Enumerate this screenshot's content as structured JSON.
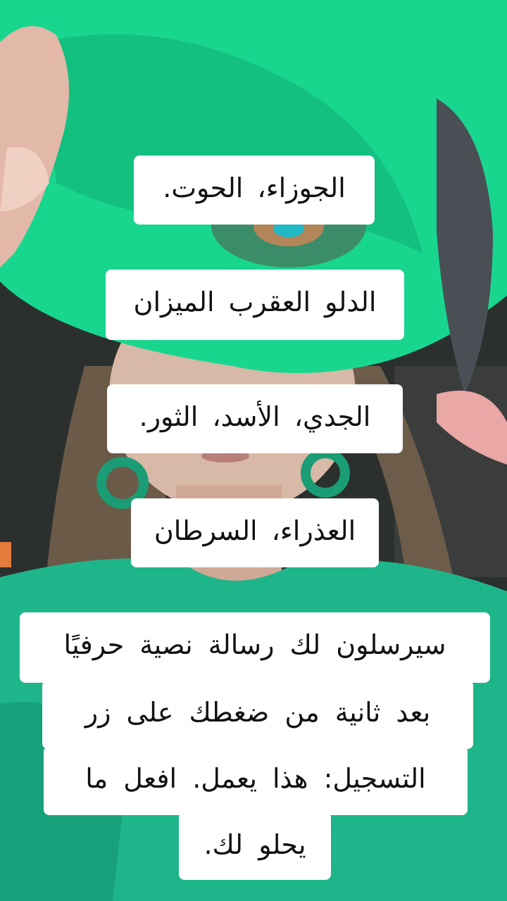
{
  "captions": [
    "الجوزاء، الحوت.",
    "الدلو العقرب الميزان",
    "الجدي، الأسد، الثور.",
    "العذراء، السرطان"
  ],
  "paragraph": {
    "lines": [
      "سيرسلون لك رسالة نصية حرفيًا",
      "بعد ثانية من ضغطك على زر",
      "التسجيل: هذا يعمل. افعل ما",
      "يحلو لك."
    ]
  },
  "colors": {
    "sweater_green": "#1fb58a",
    "feather_green": "#19d68f",
    "caption_bg": "#ffffff",
    "caption_text": "#111111"
  }
}
